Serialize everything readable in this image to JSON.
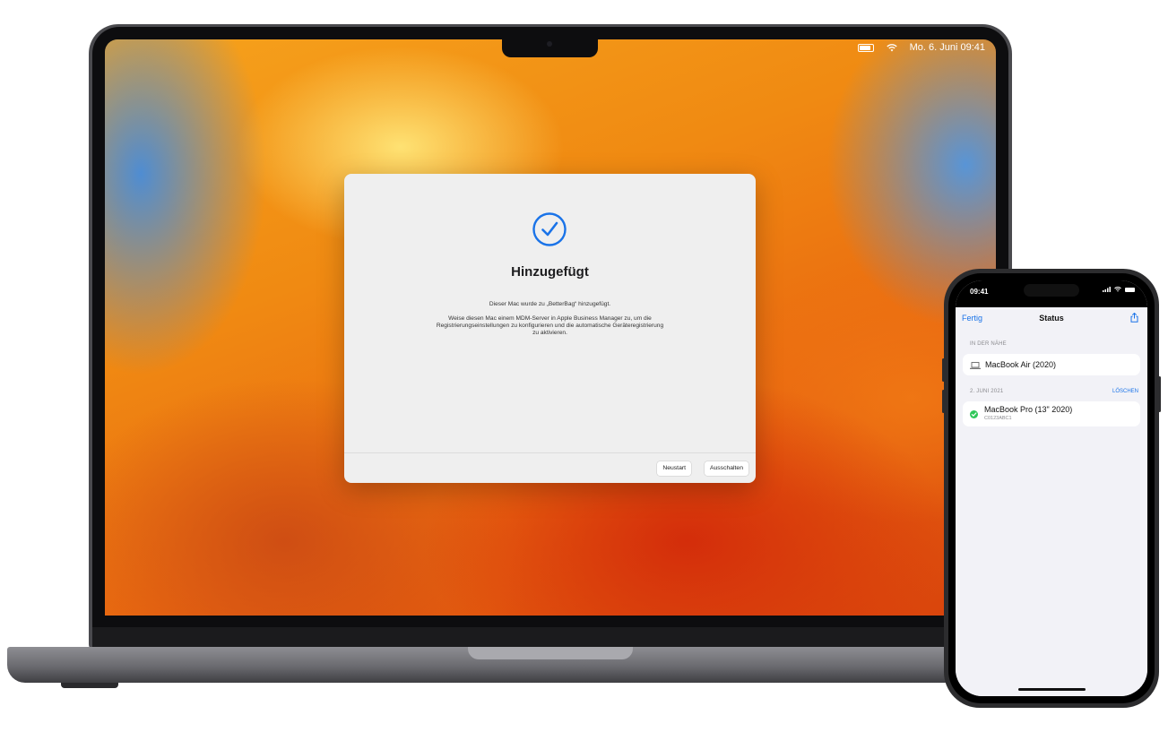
{
  "mac": {
    "menubar": {
      "datetime": "Mo. 6. Juni 09:41"
    },
    "dialog": {
      "title": "Hinzugefügt",
      "message": "Dieser Mac wurde zu „BetterBag“ hinzugefügt.",
      "detail": "Weise diesen Mac einem MDM-Server in Apple Business Manager zu, um die Registrierungseinstellungen zu konfigurieren und die automatische Geräteregistrierung zu aktivieren.",
      "buttons": {
        "restart": "Neustart",
        "shutdown": "Ausschalten"
      }
    }
  },
  "iphone": {
    "status_time": "09:41",
    "nav": {
      "done": "Fertig",
      "title": "Status"
    },
    "nearby": {
      "header": "IN DER NÄHE",
      "items": [
        {
          "name": "MacBook Air (2020)"
        }
      ]
    },
    "history": {
      "header": "2. JUNI 2021",
      "clear": "LÖSCHEN",
      "items": [
        {
          "name": "MacBook Pro (13\" 2020)",
          "serial": "C0123ABC1"
        }
      ]
    }
  },
  "colors": {
    "accent": "#1a73e8",
    "success": "#30c75a"
  }
}
